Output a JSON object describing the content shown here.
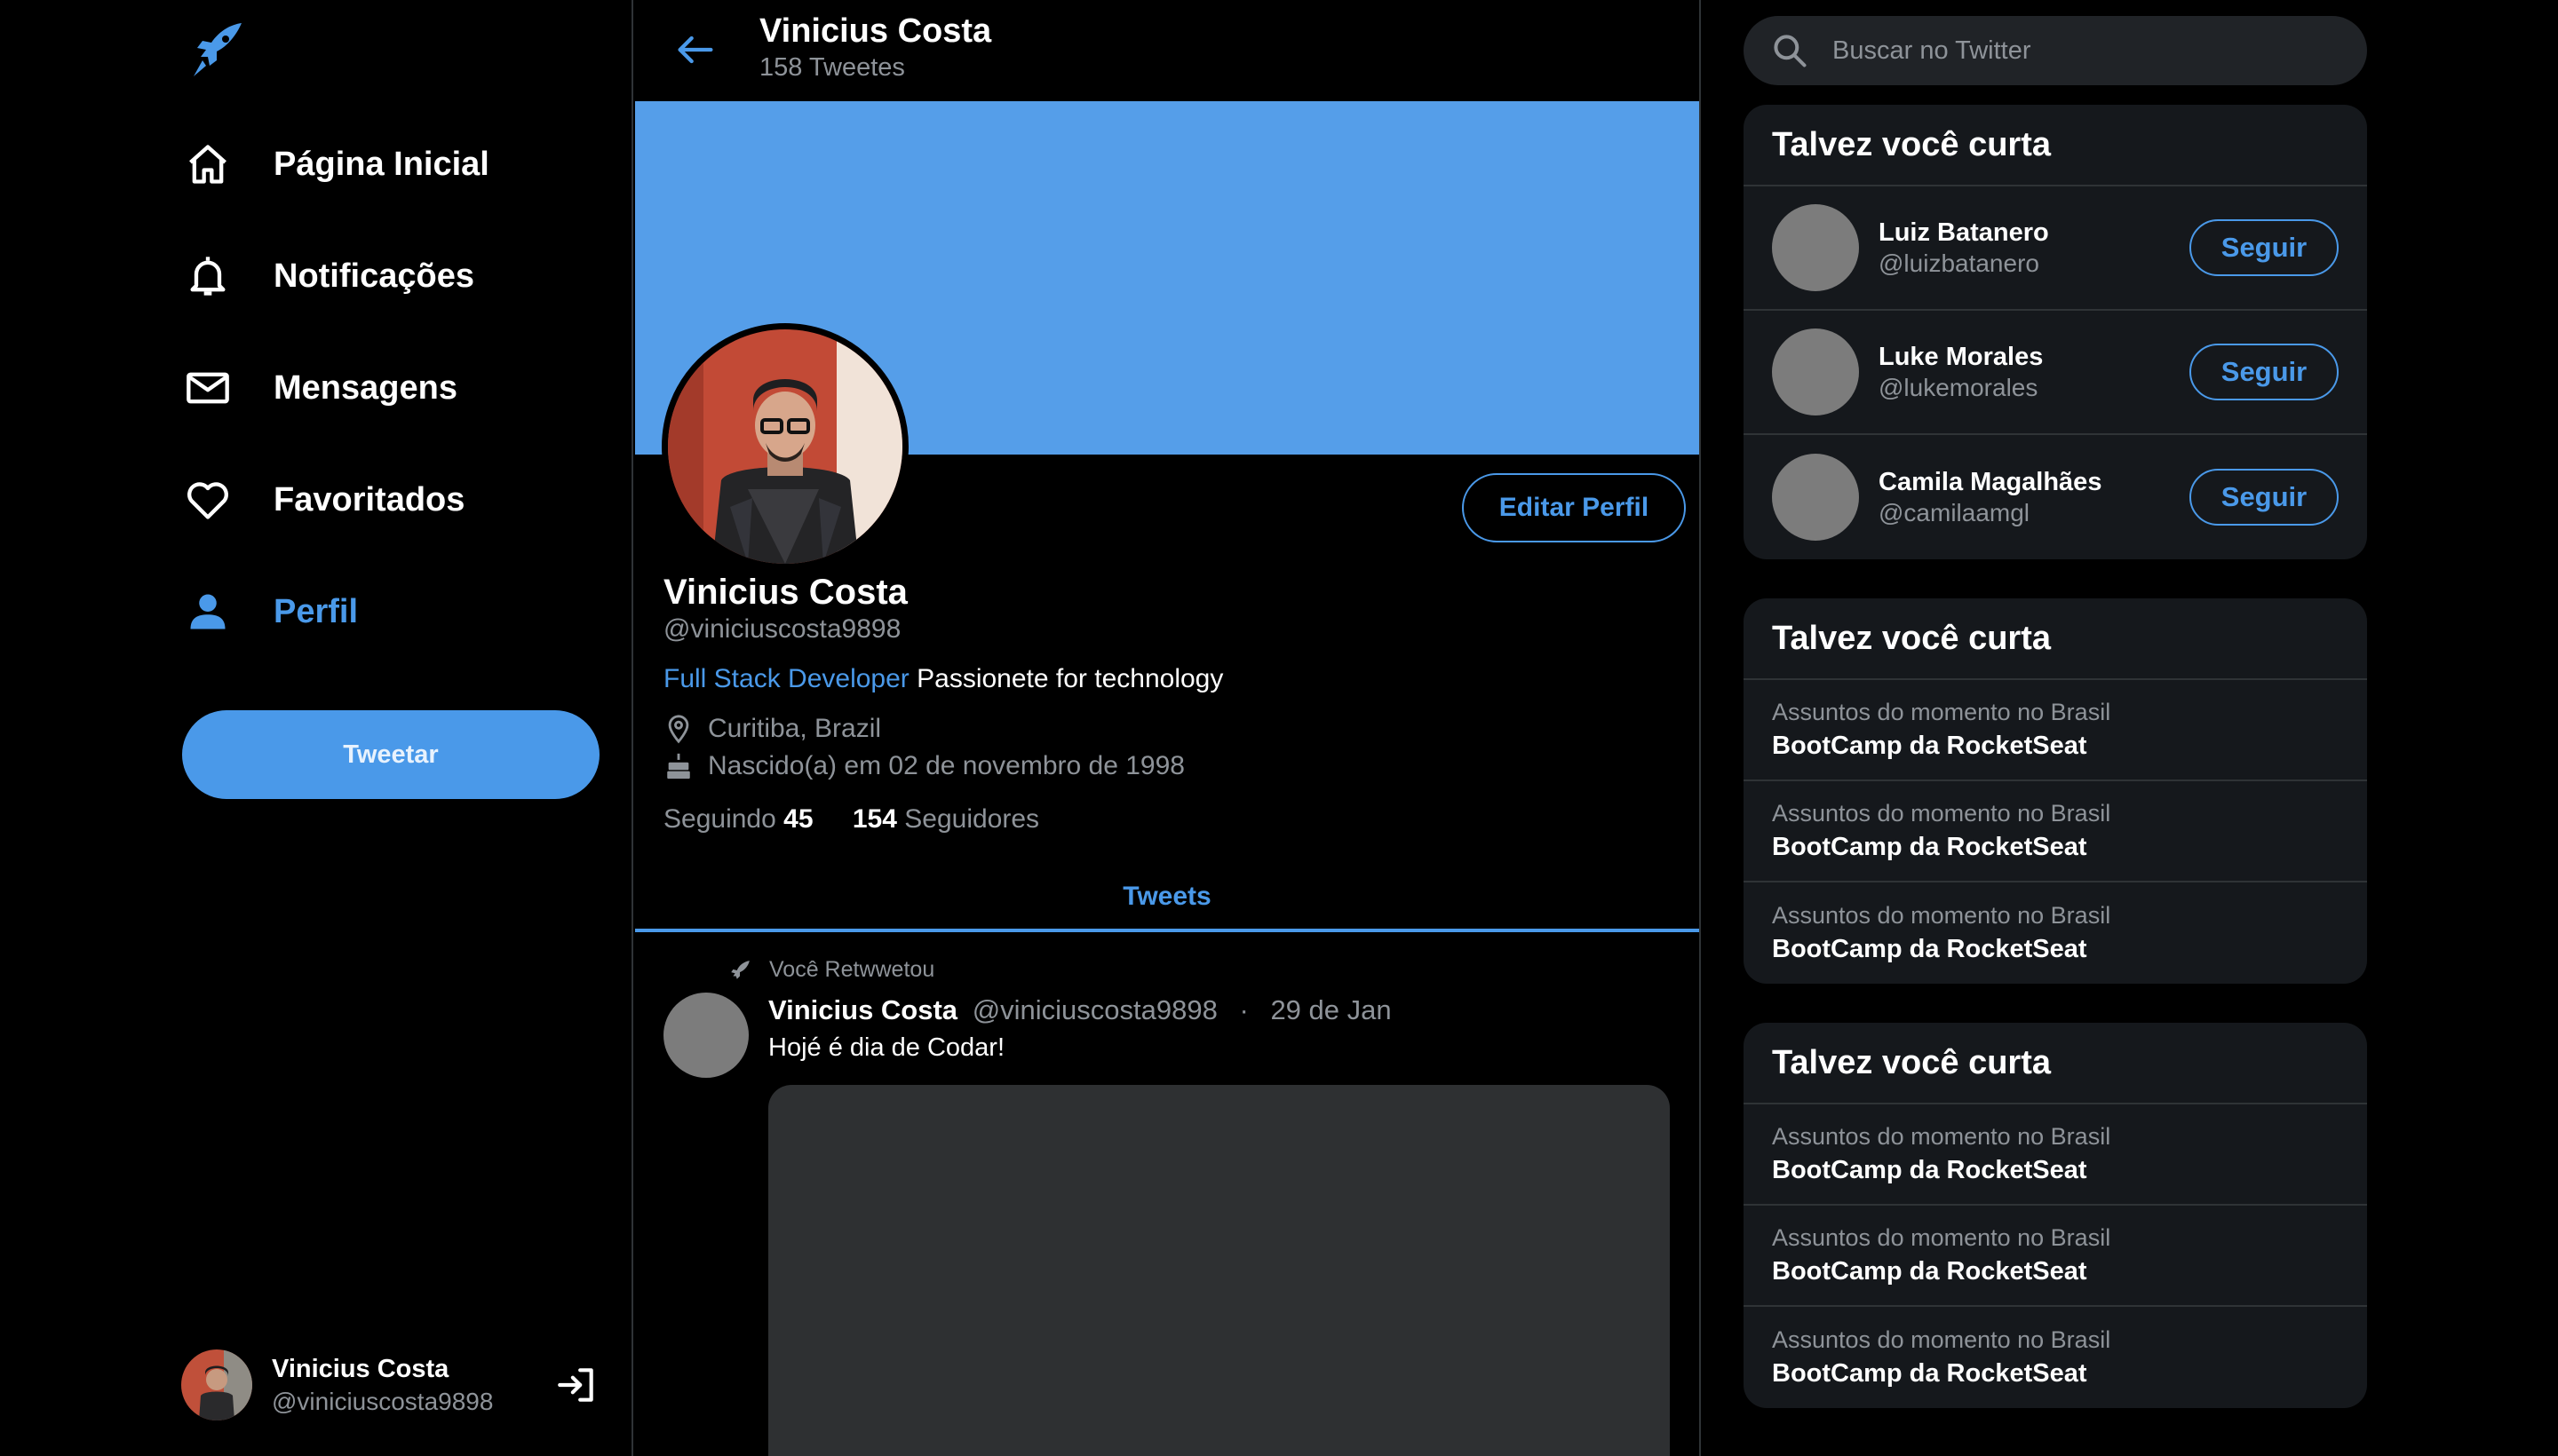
{
  "menu": {
    "items": [
      {
        "label": "Página Inicial",
        "icon": "home-icon"
      },
      {
        "label": "Notificações",
        "icon": "bell-icon"
      },
      {
        "label": "Mensagens",
        "icon": "mail-icon"
      },
      {
        "label": "Favoritados",
        "icon": "heart-icon"
      },
      {
        "label": "Perfil",
        "icon": "person-icon",
        "active": true
      }
    ],
    "tweet_button": "Tweetar",
    "user": {
      "name": "Vinicius Costa",
      "handle": "@viniciuscosta9898"
    }
  },
  "header": {
    "title": "Vinicius Costa",
    "subtitle": "158 Tweetes"
  },
  "profile": {
    "edit_button": "Editar Perfil",
    "name": "Vinicius Costa",
    "handle": "@viniciuscosta9898",
    "bio_tag": "Full Stack Developer",
    "bio_text": "Passionete for technology",
    "location": "Curitiba, Brazil",
    "birthday": "Nascido(a) em 02 de novembro de 1998",
    "following_label": "Seguindo",
    "following_count": "45",
    "followers_count": "154",
    "followers_label": "Seguidores"
  },
  "tabs": {
    "tweets": "Tweets"
  },
  "tweet": {
    "retweet_label": "Você Retwwetou",
    "author": "Vinicius Costa",
    "handle": "@viniciuscosta9898",
    "separator": "·",
    "date": "29 de Jan",
    "text": "Hojé é dia de Codar!"
  },
  "search": {
    "placeholder": "Buscar no Twitter"
  },
  "follow_card": {
    "title": "Talvez você curta",
    "button": "Seguir",
    "users": [
      {
        "name": "Luiz Batanero",
        "handle": "@luizbatanero"
      },
      {
        "name": "Luke Morales",
        "handle": "@lukemorales"
      },
      {
        "name": "Camila Magalhães",
        "handle": "@camilaamgl"
      }
    ]
  },
  "trend_cards": [
    {
      "title": "Talvez você curta",
      "items": [
        {
          "sub": "Assuntos do momento no Brasil",
          "main": "BootCamp da RocketSeat"
        },
        {
          "sub": "Assuntos do momento no Brasil",
          "main": "BootCamp da RocketSeat"
        },
        {
          "sub": "Assuntos do momento no Brasil",
          "main": "BootCamp da RocketSeat"
        }
      ]
    },
    {
      "title": "Talvez você curta",
      "items": [
        {
          "sub": "Assuntos do momento no Brasil",
          "main": "BootCamp da RocketSeat"
        },
        {
          "sub": "Assuntos do momento no Brasil",
          "main": "BootCamp da RocketSeat"
        },
        {
          "sub": "Assuntos do momento no Brasil",
          "main": "BootCamp da RocketSeat"
        }
      ]
    }
  ],
  "colors": {
    "accent": "#4a99e9",
    "banner": "#559ee9",
    "card": "#15181c",
    "muted": "#8e9399"
  }
}
